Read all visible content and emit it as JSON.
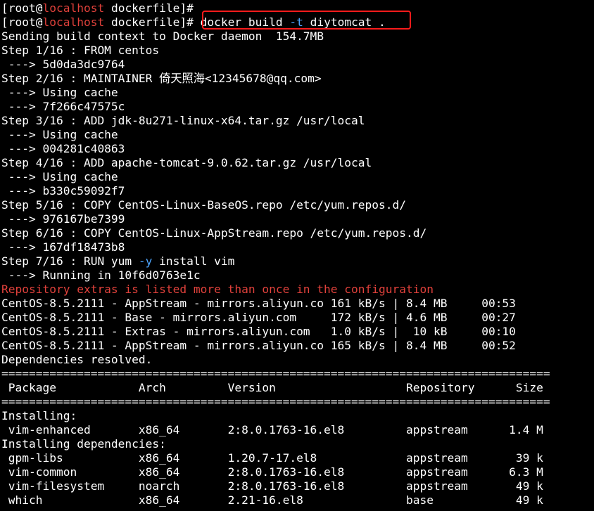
{
  "terminal": {
    "background": "#000000",
    "colors": {
      "text": "#ffffff",
      "hostname": "#e0413b",
      "warning": "#e0413b",
      "option": "#4ea6ff",
      "highlight_box": "#ff1b1b"
    },
    "lines": [
      [
        {
          "t": "[root@"
        },
        {
          "t": "localhost",
          "c": "host"
        },
        {
          "t": " dockerfile]#"
        }
      ],
      [
        {
          "t": "[root@"
        },
        {
          "t": "localhost",
          "c": "host"
        },
        {
          "t": " dockerfile]# docker build "
        },
        {
          "t": "-t",
          "c": "opt"
        },
        {
          "t": " diytomcat ."
        }
      ],
      [
        {
          "t": "Sending build context to Docker daemon  154.7MB"
        }
      ],
      [
        {
          "t": "Step 1/16 : FROM centos"
        }
      ],
      [
        {
          "t": " ---> 5d0da3dc9764"
        }
      ],
      [
        {
          "t": "Step 2/16 : MAINTAINER 倚天照海<12345678@qq.com>"
        }
      ],
      [
        {
          "t": " ---> Using cache"
        }
      ],
      [
        {
          "t": " ---> 7f266c47575c"
        }
      ],
      [
        {
          "t": "Step 3/16 : ADD jdk-8u271-linux-x64.tar.gz /usr/local"
        }
      ],
      [
        {
          "t": " ---> Using cache"
        }
      ],
      [
        {
          "t": " ---> 004281c40863"
        }
      ],
      [
        {
          "t": "Step 4/16 : ADD apache-tomcat-9.0.62.tar.gz /usr/local"
        }
      ],
      [
        {
          "t": " ---> Using cache"
        }
      ],
      [
        {
          "t": " ---> b330c59092f7"
        }
      ],
      [
        {
          "t": "Step 5/16 : COPY CentOS-Linux-BaseOS.repo /etc/yum.repos.d/"
        }
      ],
      [
        {
          "t": " ---> 976167be7399"
        }
      ],
      [
        {
          "t": "Step 6/16 : COPY CentOS-Linux-AppStream.repo /etc/yum.repos.d/"
        }
      ],
      [
        {
          "t": " ---> 167df18473b8"
        }
      ],
      [
        {
          "t": "Step 7/16 : RUN yum "
        },
        {
          "t": "-y",
          "c": "opt"
        },
        {
          "t": " install vim"
        }
      ],
      [
        {
          "t": " ---> Running in 10f6d0763e1c"
        }
      ],
      [
        {
          "t": "Repository extras is listed more than once in the configuration",
          "c": "err"
        }
      ],
      [
        {
          "t": "CentOS-8.5.2111 - AppStream - mirrors.aliyun.co 161 kB/s | 8.4 MB     00:53"
        }
      ],
      [
        {
          "t": "CentOS-8.5.2111 - Base - mirrors.aliyun.com     172 kB/s | 4.6 MB     00:27"
        }
      ],
      [
        {
          "t": "CentOS-8.5.2111 - Extras - mirrors.aliyun.com   1.0 kB/s |  10 kB     00:10"
        }
      ],
      [
        {
          "t": "CentOS-8.5.2111 - AppStream - mirrors.aliyun.co 165 kB/s | 8.4 MB     00:52"
        }
      ],
      [
        {
          "t": "Dependencies resolved."
        }
      ],
      [
        {
          "t": "================================================================================"
        }
      ],
      [
        {
          "t": " Package            Arch         Version                   Repository      Size"
        }
      ],
      [
        {
          "t": "================================================================================"
        }
      ],
      [
        {
          "t": "Installing:"
        }
      ],
      [
        {
          "t": " vim-enhanced       x86_64       2:8.0.1763-16.el8         appstream      1.4 M"
        }
      ],
      [
        {
          "t": "Installing dependencies:"
        }
      ],
      [
        {
          "t": " gpm-libs           x86_64       1.20.7-17.el8             appstream       39 k"
        }
      ],
      [
        {
          "t": " vim-common         x86_64       2:8.0.1763-16.el8         appstream      6.3 M"
        }
      ],
      [
        {
          "t": " vim-filesystem     noarch       2:8.0.1763-16.el8         appstream       49 k"
        }
      ],
      [
        {
          "t": " which              x86_64       2.21-16.el8               base            49 k"
        }
      ]
    ]
  }
}
